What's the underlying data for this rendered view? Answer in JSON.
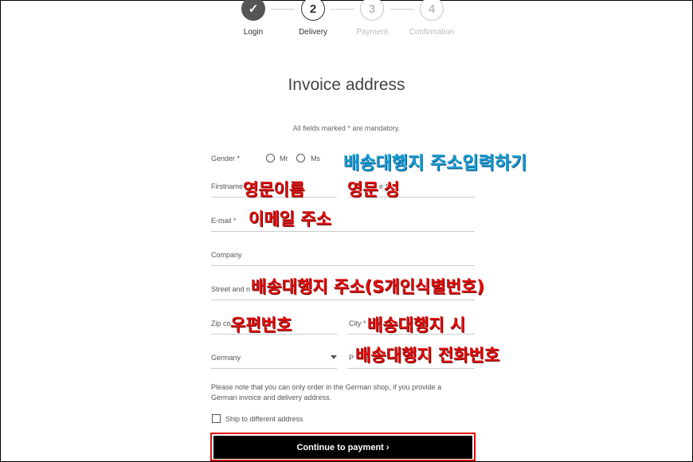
{
  "steps": [
    {
      "number": "✓",
      "label": "Login"
    },
    {
      "number": "2",
      "label": "Delivery"
    },
    {
      "number": "3",
      "label": "Payment"
    },
    {
      "number": "4",
      "label": "Confirmation"
    }
  ],
  "form": {
    "title": "Invoice address",
    "mandatory_note": "All fields marked * are mandatory.",
    "gender_label": "Gender *",
    "gender_options": [
      "Mr",
      "Ms"
    ],
    "firstname_label": "Firstname",
    "lastname_label": "e *",
    "email_label": "E-mail *",
    "company_label": "Company",
    "street_label": "Street and n",
    "zip_label": "Zip co",
    "city_label": "City *",
    "country_value": "Germany",
    "phone_label": "P",
    "notice": "Please note that you can only order in the German shop, if you provide a German invoice and delivery address.",
    "ship_different_label": "Ship to different address",
    "continue_button": "Continue to payment ›"
  },
  "annotations": {
    "header": "배송대행지 주소입력하기",
    "firstname": "영문이름",
    "lastname": "영문 성",
    "email": "이메일 주소",
    "street": "배송대행지 주소(S개인식별번호)",
    "zip": "우편번호",
    "city": "배송대행지 시",
    "phone": "배송대행지 전화번호"
  },
  "colors": {
    "annotation_red": "#e01010",
    "annotation_blue": "#1a9ed8",
    "button_bg": "#000000"
  }
}
